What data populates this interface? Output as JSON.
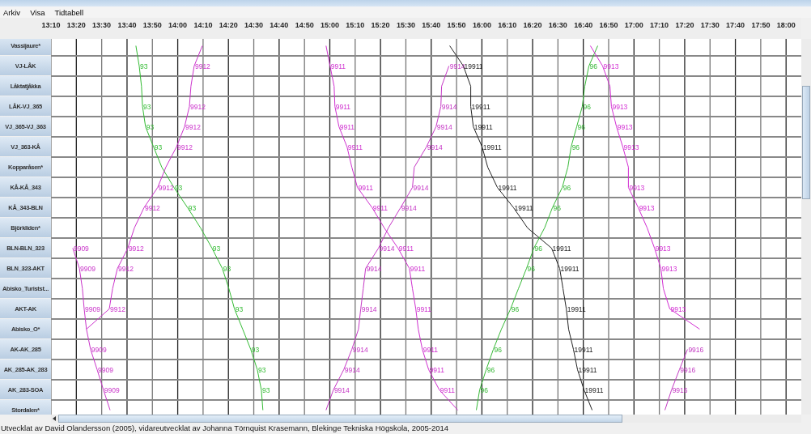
{
  "menu": [
    "Arkiv",
    "Visa",
    "Tidtabell"
  ],
  "row_is_station": [
    true,
    false,
    true,
    false,
    false,
    false,
    true,
    false,
    false,
    true,
    false,
    false,
    true,
    false,
    true,
    false,
    false,
    false,
    true
  ],
  "chart_data": {
    "type": "line",
    "orientation": "horizontal",
    "grid": true,
    "categories": [
      "Vassijaure*",
      "VJ-LÅK",
      "Låktatjåkka",
      "LÅK-VJ_365",
      "VJ_365-VJ_363",
      "VJ_363-KÅ",
      "Kopparåsen*",
      "KÅ-KÅ_343",
      "KÅ_343-BLN",
      "Björkliden*",
      "BLN-BLN_323",
      "BLN_323-AKT",
      "Abisko_Turistst...",
      "AKT-AK",
      "Abisko_O*",
      "AK-AK_285",
      "AK_285-AK_283",
      "AK_283-SOA",
      "Stordalen*"
    ],
    "xlim": [
      790,
      1086
    ],
    "xticks": [
      {
        "value": 790,
        "label": "13:10"
      },
      {
        "value": 800,
        "label": "13:20"
      },
      {
        "value": 810,
        "label": "13:30"
      },
      {
        "value": 820,
        "label": "13:40"
      },
      {
        "value": 830,
        "label": "13:50"
      },
      {
        "value": 840,
        "label": "14:00"
      },
      {
        "value": 850,
        "label": "14:10"
      },
      {
        "value": 860,
        "label": "14:20"
      },
      {
        "value": 870,
        "label": "14:30"
      },
      {
        "value": 880,
        "label": "14:40"
      },
      {
        "value": 890,
        "label": "14:50"
      },
      {
        "value": 900,
        "label": "15:00"
      },
      {
        "value": 910,
        "label": "15:10"
      },
      {
        "value": 920,
        "label": "15:20"
      },
      {
        "value": 930,
        "label": "15:30"
      },
      {
        "value": 940,
        "label": "15:40"
      },
      {
        "value": 950,
        "label": "15:50"
      },
      {
        "value": 960,
        "label": "16:00"
      },
      {
        "value": 970,
        "label": "16:10"
      },
      {
        "value": 980,
        "label": "16:20"
      },
      {
        "value": 990,
        "label": "16:30"
      },
      {
        "value": 1000,
        "label": "16:40"
      },
      {
        "value": 1010,
        "label": "16:50"
      },
      {
        "value": 1020,
        "label": "17:00"
      },
      {
        "value": 1030,
        "label": "17:10"
      },
      {
        "value": 1040,
        "label": "17:20"
      },
      {
        "value": 1050,
        "label": "17:30"
      },
      {
        "value": 1060,
        "label": "17:40"
      },
      {
        "value": 1070,
        "label": "17:50"
      },
      {
        "value": 1080,
        "label": "18:00"
      }
    ],
    "series": [
      {
        "name": "93",
        "color": "#33bb33",
        "values": [
          823.5,
          824.8,
          825.7,
          826.1,
          827.3,
          830.5,
          833.7,
          838.5,
          843.9,
          849.0,
          853.5,
          857.6,
          860.2,
          862.4,
          865.6,
          868.8,
          871.4,
          873.0,
          873.6
        ]
      },
      {
        "name": "9912",
        "color": "#cc33cc",
        "values": [
          849.7,
          846.5,
          845.2,
          844.6,
          842.7,
          839.5,
          835.3,
          832.1,
          826.7,
          822.9,
          820.3,
          816.2,
          814.3,
          813.0,
          804.0,
          null,
          null,
          null,
          null
        ]
      },
      {
        "name": "9909",
        "color": "#c936c9",
        "values": [
          null,
          null,
          null,
          null,
          null,
          null,
          null,
          null,
          null,
          null,
          798.6,
          801.2,
          802.4,
          803.1,
          804.0,
          805.6,
          808.2,
          810.7,
          813.3
        ]
      },
      {
        "name": "9911",
        "color": "#cf30cf",
        "values": [
          898.5,
          900.1,
          901.7,
          902.0,
          903.6,
          906.8,
          908.7,
          910.9,
          916.7,
          921.5,
          926.9,
          931.4,
          932.6,
          933.9,
          934.9,
          936.5,
          939.0,
          943.2,
          950.5
        ]
      },
      {
        "name": "9914",
        "color": "#c638c6",
        "values": [
          null,
          947.0,
          944.1,
          943.8,
          941.9,
          938.1,
          933.3,
          932.6,
          927.9,
          923.1,
          919.2,
          914.1,
          913.2,
          912.2,
          911.3,
          908.7,
          905.5,
          901.4,
          898.5
        ]
      },
      {
        "name": "19911",
        "color": "#222222",
        "values": [
          947.3,
          952.7,
          955.6,
          955.6,
          956.6,
          960.1,
          962.3,
          966.1,
          972.5,
          978.0,
          987.5,
          990.7,
          992.0,
          993.3,
          994.2,
          996.1,
          997.7,
          1000.3,
          1003.5
        ]
      },
      {
        "name": "96",
        "color": "#36b836",
        "values": [
          1005.7,
          1002.2,
          1000.6,
          999.6,
          997.4,
          995.2,
          993.9,
          991.7,
          987.8,
          984.7,
          980.5,
          977.6,
          974.4,
          971.3,
          967.7,
          964.5,
          961.7,
          959.1,
          957.8
        ]
      },
      {
        "name": "9913",
        "color": "#d22dd2",
        "values": [
          1002.8,
          1007.6,
          1010.5,
          1011.1,
          1013.1,
          1015.6,
          1017.8,
          1017.8,
          1021.7,
          1025.2,
          1028.1,
          1030.6,
          1031.6,
          1034.1,
          1045.9,
          null,
          null,
          null,
          null
        ]
      },
      {
        "name": "9916",
        "color": "#c33bc3",
        "values": [
          null,
          null,
          null,
          null,
          null,
          null,
          null,
          null,
          null,
          null,
          null,
          null,
          null,
          null,
          null,
          1041.1,
          1037.9,
          1034.8,
          1032.2
        ]
      }
    ]
  },
  "status_bar": "Utvecklat av David Olandersson (2005), vidareutvecklat av Johanna Törnquist Krasemann, Blekinge Tekniska Högskola, 2005-2014"
}
